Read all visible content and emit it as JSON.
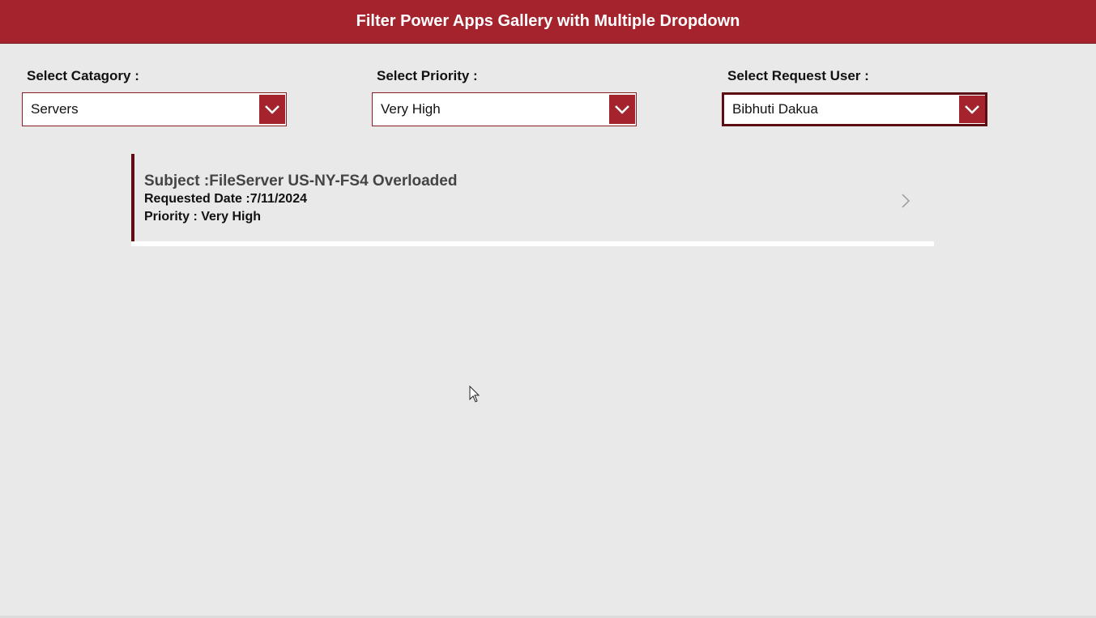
{
  "header": {
    "title": "Filter Power Apps Gallery with Multiple Dropdown"
  },
  "filters": {
    "category": {
      "label": "Select Catagory :",
      "value": "Servers"
    },
    "priority": {
      "label": "Select Priority :",
      "value": "Very High"
    },
    "request_user": {
      "label": "Select Request User :",
      "value": "Bibhuti Dakua"
    }
  },
  "gallery": {
    "items": [
      {
        "subject": "Subject :FileServer US-NY-FS4 Overloaded",
        "requested_date": "Requested Date :7/11/2024",
        "priority": "Priority : Very High",
        "chevron_icon": "chevron-right-icon"
      }
    ]
  },
  "colors": {
    "header_bg": "#a4232c",
    "accent_dark": "#5c0e13",
    "background": "#e9e9e9"
  }
}
